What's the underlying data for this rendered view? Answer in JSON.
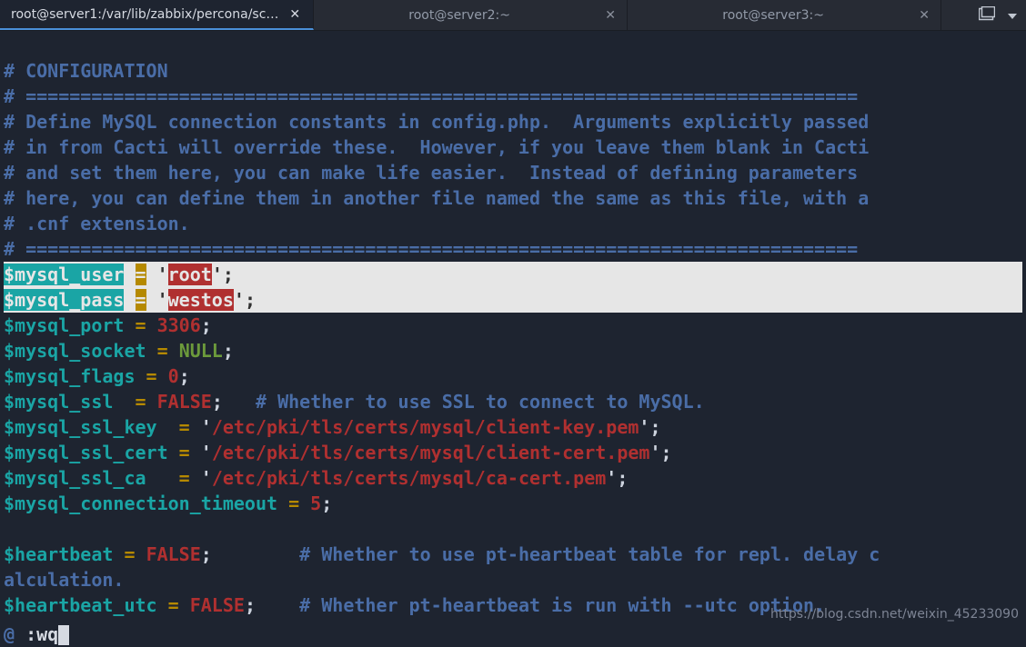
{
  "tabs": [
    {
      "title": "root@server1:/var/lib/zabbix/percona/sc…",
      "active": true
    },
    {
      "title": "root@server2:~",
      "active": false
    },
    {
      "title": "root@server3:~",
      "active": false
    }
  ],
  "comments": {
    "l1": "# CONFIGURATION",
    "l2": "# ============================================================================",
    "l3": "# Define MySQL connection constants in config.php.  Arguments explicitly passed",
    "l4": "# in from Cacti will override these.  However, if you leave them blank in Cacti",
    "l5": "# and set them here, you can make life easier.  Instead of defining parameters",
    "l6": "# here, you can define them in another file named the same as this file, with a",
    "l7": "# .cnf extension.",
    "l8": "# ============================================================================",
    "ssl": "# Whether to use SSL to connect to MySQL.",
    "heartbeat": "# Whether to use pt-heartbeat table for repl. delay c",
    "hb_utc": "# Whether pt-heartbeat is run with --utc option."
  },
  "vars": {
    "mysql_user": {
      "name": "$mysql_user",
      "value": "root",
      "quoted": true
    },
    "mysql_pass": {
      "name": "$mysql_pass",
      "value": "westos",
      "quoted": true
    },
    "mysql_port": {
      "name": "$mysql_port",
      "value": "3306"
    },
    "mysql_socket": {
      "name": "$mysql_socket",
      "value": "NULL"
    },
    "mysql_flags": {
      "name": "$mysql_flags",
      "value": "0"
    },
    "mysql_ssl": {
      "name": "$mysql_ssl",
      "value": "FALSE"
    },
    "mysql_ssl_key": {
      "name": "$mysql_ssl_key",
      "value": "/etc/pki/tls/certs/mysql/client-key.pem"
    },
    "mysql_ssl_cert": {
      "name": "$mysql_ssl_cert",
      "value": "/etc/pki/tls/certs/mysql/client-cert.pem"
    },
    "mysql_ssl_ca": {
      "name": "$mysql_ssl_ca",
      "value": "/etc/pki/tls/certs/mysql/ca-cert.pem"
    },
    "mysql_connection_timeout": {
      "name": "$mysql_connection_timeout",
      "value": "5"
    },
    "heartbeat": {
      "name": "$heartbeat",
      "value": "FALSE"
    },
    "heartbeat_utc": {
      "name": "$heartbeat_utc",
      "value": "FALSE"
    }
  },
  "misc": {
    "alculation": "alculation.",
    "at": "@",
    "cmd": ":wq"
  },
  "watermark": "https://blog.csdn.net/weixin_45233090"
}
